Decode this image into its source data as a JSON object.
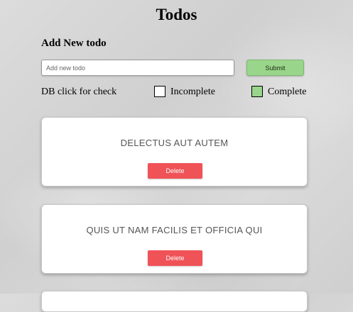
{
  "header": {
    "title": "Todos"
  },
  "form": {
    "section_label": "Add New todo",
    "input_placeholder": "Add new todo",
    "input_value": "",
    "submit_label": "Submit"
  },
  "legend": {
    "hint": "DB click for check",
    "incomplete_label": "Incomplete",
    "complete_label": "Complete",
    "incomplete_color": "#ffffff",
    "complete_color": "#99d58a"
  },
  "todos": [
    {
      "title": "DELECTUS AUT AUTEM",
      "delete_label": "Delete",
      "complete": false
    },
    {
      "title": "QUIS UT NAM FACILIS ET OFFICIA QUI",
      "delete_label": "Delete",
      "complete": false
    },
    {
      "title": "",
      "delete_label": "",
      "complete": false
    }
  ],
  "colors": {
    "submit": "#99d58a",
    "delete": "#ef5257",
    "card_background": "#ffffff",
    "page_background": "#d9d9d9"
  }
}
